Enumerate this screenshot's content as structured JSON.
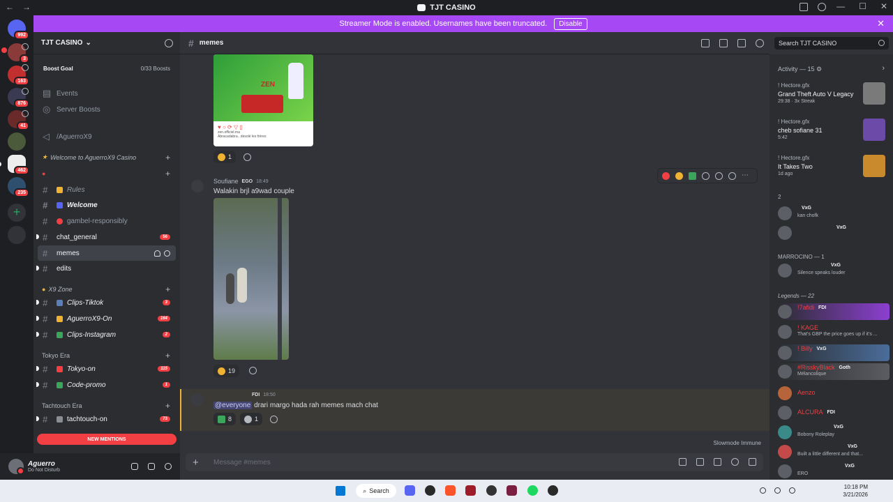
{
  "window": {
    "title": "TJT CASINO"
  },
  "banner": {
    "text": "Streamer Mode is enabled. Usernames have been truncated.",
    "disable_label": "Disable"
  },
  "rail": {
    "badges": [
      "992",
      "3",
      "163",
      "876",
      "41",
      "462",
      "235"
    ]
  },
  "server": {
    "name": "TJT CASINO",
    "boost_label": "Boost Goal",
    "boost_value": "0/33 Boosts"
  },
  "sidebar": {
    "top_items": [
      {
        "label": "Events"
      },
      {
        "label": "Server Boosts"
      },
      {
        "label": "/AguerroX9"
      }
    ],
    "categories": {
      "welcome": "Welcome to AguerroX9 Casino",
      "x9zone": "X9 Zone",
      "tokyo": "Tokyo Era",
      "tachtouch": "Tachtouch Era"
    },
    "channels": [
      {
        "name": "Rules"
      },
      {
        "name": "Welcome"
      },
      {
        "name": "gambel-responsibly"
      },
      {
        "name": "chat_general",
        "badge": "56"
      },
      {
        "name": "memes"
      },
      {
        "name": "edits"
      },
      {
        "name": "Clips-Tiktok",
        "badge": "3"
      },
      {
        "name": "AguerroX9-On",
        "badge": "164"
      },
      {
        "name": "Clips-Instagram",
        "badge": "2"
      },
      {
        "name": "Tokyo-on",
        "badge": "115"
      },
      {
        "name": "Code-promo",
        "badge": "1"
      },
      {
        "name": "tachtouch-on",
        "badge": "73"
      }
    ],
    "new_mentions": "NEW MENTIONS"
  },
  "user": {
    "name": "Aguerro",
    "status": "Do Not Disturb"
  },
  "channel": {
    "name": "memes"
  },
  "search": {
    "placeholder": "Search TJT CASINO"
  },
  "messages": [
    {
      "image_caption": "ZEN",
      "post_meta": "zen.officiel.ma",
      "post_sub": "Abracadabra.. dėsolė les frères",
      "reactions": [
        {
          "count": "1"
        }
      ]
    },
    {
      "author": "Soufiane",
      "tag": "EGO",
      "time": "18:49",
      "text": "Walakin brjl a9wad couple",
      "reactions": [
        {
          "count": "19"
        }
      ]
    },
    {
      "author": "",
      "tag": "FDI",
      "time": "18:50",
      "mention": "@everyone",
      "text": "drari margo hada rah memes mach chat",
      "reactions": [
        {
          "count": "8"
        },
        {
          "count": "1"
        }
      ]
    }
  ],
  "slowmode": "Slowmode Immune",
  "composer": {
    "placeholder": "Message #memes"
  },
  "members": {
    "activity_title": "Activity — 15",
    "activities": [
      {
        "who": "! Hectore.gfx",
        "game": "Grand Theft Auto V Legacy",
        "meta": "29:38 · 3x Streak"
      },
      {
        "who": "! Hectore.gfx",
        "game": "cheb sofiane 31",
        "meta": "5:42"
      },
      {
        "who": "! Hectore.gfx",
        "game": "It Takes Two",
        "meta": "1d ago"
      }
    ],
    "groups": {
      "g1": "2",
      "marrocino": "MARROCINO — 1",
      "legends": "Legends — 22"
    },
    "list": [
      {
        "name": "",
        "tag": "VxG",
        "status": "kan chofk"
      },
      {
        "name": "",
        "tag": "VxG",
        "status": ""
      },
      {
        "name": "",
        "tag": "VxG",
        "status": "Silence speaks louder"
      },
      {
        "name": "!7afidi",
        "tag": "FDI",
        "status": ""
      },
      {
        "name": "! KAGE",
        "tag": "",
        "status": "That's GBP the price goes up if it's ..."
      },
      {
        "name": "! Billy",
        "tag": "VxG",
        "status": ""
      },
      {
        "name": "#RisskyBlack",
        "tag": "Goth",
        "status": "Mélancolique"
      },
      {
        "name": "Aenzo",
        "tag": "",
        "status": ""
      },
      {
        "name": "ALCURA",
        "tag": "FDI",
        "status": ""
      },
      {
        "name": "",
        "tag": "VxG",
        "status": "Bobony Roleplay"
      },
      {
        "name": "",
        "tag": "VxG",
        "status": "Built a little different and that..."
      },
      {
        "name": "",
        "tag": "VxG",
        "status": "ERO"
      }
    ]
  },
  "taskbar": {
    "search": "Search",
    "time": "10:18 PM",
    "date": "3/21/2026"
  },
  "colors": {
    "accent": "#5865f2",
    "banner": "#a649f5",
    "mention": "#f23f43"
  }
}
